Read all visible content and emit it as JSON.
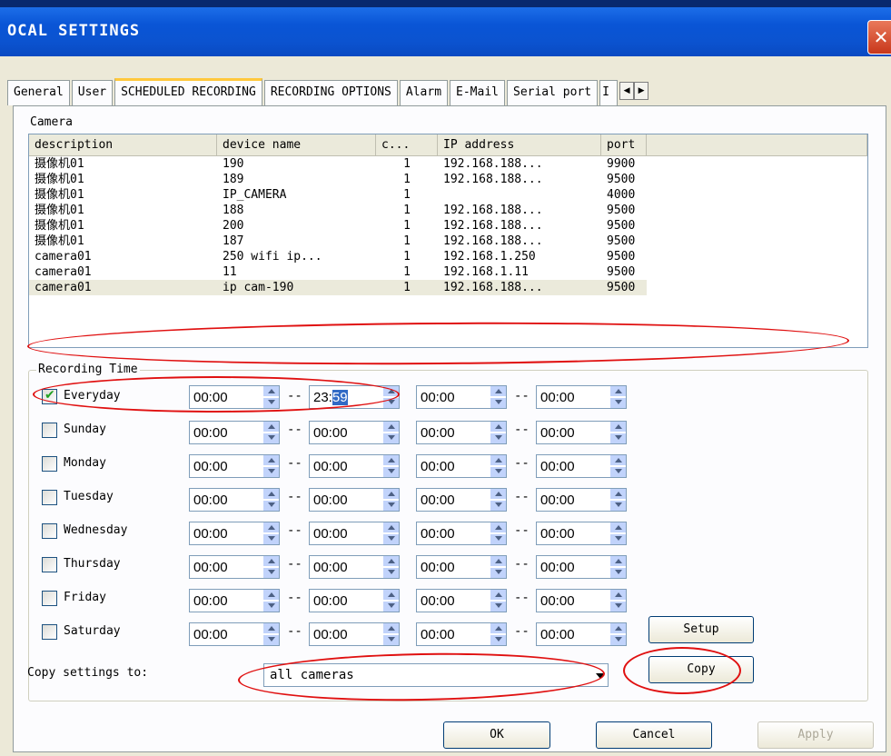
{
  "window": {
    "title": "OCAL SETTINGS",
    "close_symbol": "✕"
  },
  "tabs": [
    {
      "label": "General",
      "active": false
    },
    {
      "label": "User",
      "active": false
    },
    {
      "label": "SCHEDULED RECORDING",
      "active": true
    },
    {
      "label": "RECORDING OPTIONS",
      "active": false
    },
    {
      "label": "Alarm",
      "active": false
    },
    {
      "label": "E-Mail",
      "active": false
    },
    {
      "label": "Serial port",
      "active": false
    },
    {
      "label": "I",
      "active": false
    }
  ],
  "tab_scroll": {
    "left": "◀",
    "right": "▶"
  },
  "camera_section": {
    "label": "Camera"
  },
  "camera_table": {
    "headers": [
      "description",
      "device name",
      "c...",
      "IP address",
      "port"
    ],
    "rows": [
      [
        "摄像机01",
        "190",
        "1",
        "192.168.188...",
        "9900"
      ],
      [
        "摄像机01",
        "189",
        "1",
        "192.168.188...",
        "9500"
      ],
      [
        "摄像机01",
        "IP_CAMERA",
        "1",
        "",
        "4000"
      ],
      [
        "摄像机01",
        "188",
        "1",
        "192.168.188...",
        "9500"
      ],
      [
        "摄像机01",
        "200",
        "1",
        "192.168.188...",
        "9500"
      ],
      [
        "摄像机01",
        "187",
        "1",
        "192.168.188...",
        "9500"
      ],
      [
        "camera01",
        "250 wifi ip...",
        "1",
        "192.168.1.250",
        "9500"
      ],
      [
        "camera01",
        "11",
        "1",
        "192.168.1.11",
        "9500"
      ],
      [
        "camera01",
        "ip cam-190",
        "1",
        "192.168.188...",
        "9500"
      ]
    ],
    "selected_index": 8
  },
  "recording_time": {
    "label": "Recording Time",
    "days": [
      {
        "label": "Everyday",
        "checked": true,
        "times": [
          "00:00",
          "23:",
          "00:00",
          "00:00"
        ],
        "selected_text": "59"
      },
      {
        "label": "Sunday",
        "checked": false,
        "times": [
          "00:00",
          "00:00",
          "00:00",
          "00:00"
        ]
      },
      {
        "label": "Monday",
        "checked": false,
        "times": [
          "00:00",
          "00:00",
          "00:00",
          "00:00"
        ]
      },
      {
        "label": "Tuesday",
        "checked": false,
        "times": [
          "00:00",
          "00:00",
          "00:00",
          "00:00"
        ]
      },
      {
        "label": "Wednesday",
        "checked": false,
        "times": [
          "00:00",
          "00:00",
          "00:00",
          "00:00"
        ]
      },
      {
        "label": "Thursday",
        "checked": false,
        "times": [
          "00:00",
          "00:00",
          "00:00",
          "00:00"
        ]
      },
      {
        "label": "Friday",
        "checked": false,
        "times": [
          "00:00",
          "00:00",
          "00:00",
          "00:00"
        ]
      },
      {
        "label": "Saturday",
        "checked": false,
        "times": [
          "00:00",
          "00:00",
          "00:00",
          "00:00"
        ]
      }
    ],
    "separator": "--"
  },
  "buttons": {
    "setup": "Setup",
    "copy": "Copy",
    "ok": "OK",
    "cancel": "Cancel",
    "apply": "Apply"
  },
  "copy_settings": {
    "label": "Copy settings to:",
    "value": "all cameras"
  },
  "colors": {
    "titlebar": "#0a55d6",
    "annotation": "#e01010",
    "selection": "#316ac5",
    "checkmark": "#21a121"
  }
}
